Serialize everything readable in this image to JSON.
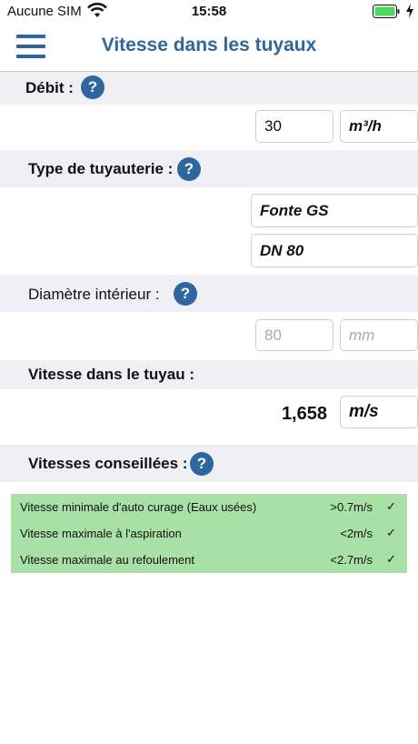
{
  "status": {
    "carrier": "Aucune SIM",
    "time": "15:58"
  },
  "nav": {
    "title": "Vitesse dans les tuyaux"
  },
  "debit": {
    "label": "Débit :",
    "value": "30",
    "unit": "m³/h"
  },
  "tuyauterie": {
    "label": "Type de tuyauterie :",
    "material": "Fonte GS",
    "size": "DN 80"
  },
  "diametre": {
    "label": "Diamètre intérieur :",
    "value": "80",
    "unit": "mm"
  },
  "vitesse": {
    "label": "Vitesse dans le tuyau :",
    "value": "1,658",
    "unit": "m/s"
  },
  "conseils": {
    "label": "Vitesses conseillées :",
    "rows": [
      {
        "label": "Vitesse minimale d'auto curage (Eaux usées)",
        "value": ">0.7m/s",
        "check": "✓"
      },
      {
        "label": "Vitesse maximale à l'aspiration",
        "value": "<2m/s",
        "check": "✓"
      },
      {
        "label": "Vitesse maximale au refoulement",
        "value": "<2.7m/s",
        "check": "✓"
      }
    ]
  },
  "colors": {
    "accent": "#2f66a0",
    "section_bg": "#efeff4",
    "advice_bg": "#a8e0a6",
    "battery": "#4cd964"
  },
  "icons": {
    "help": "question-mark",
    "menu": "hamburger",
    "wifi": "wifi",
    "battery": "battery-charging"
  }
}
